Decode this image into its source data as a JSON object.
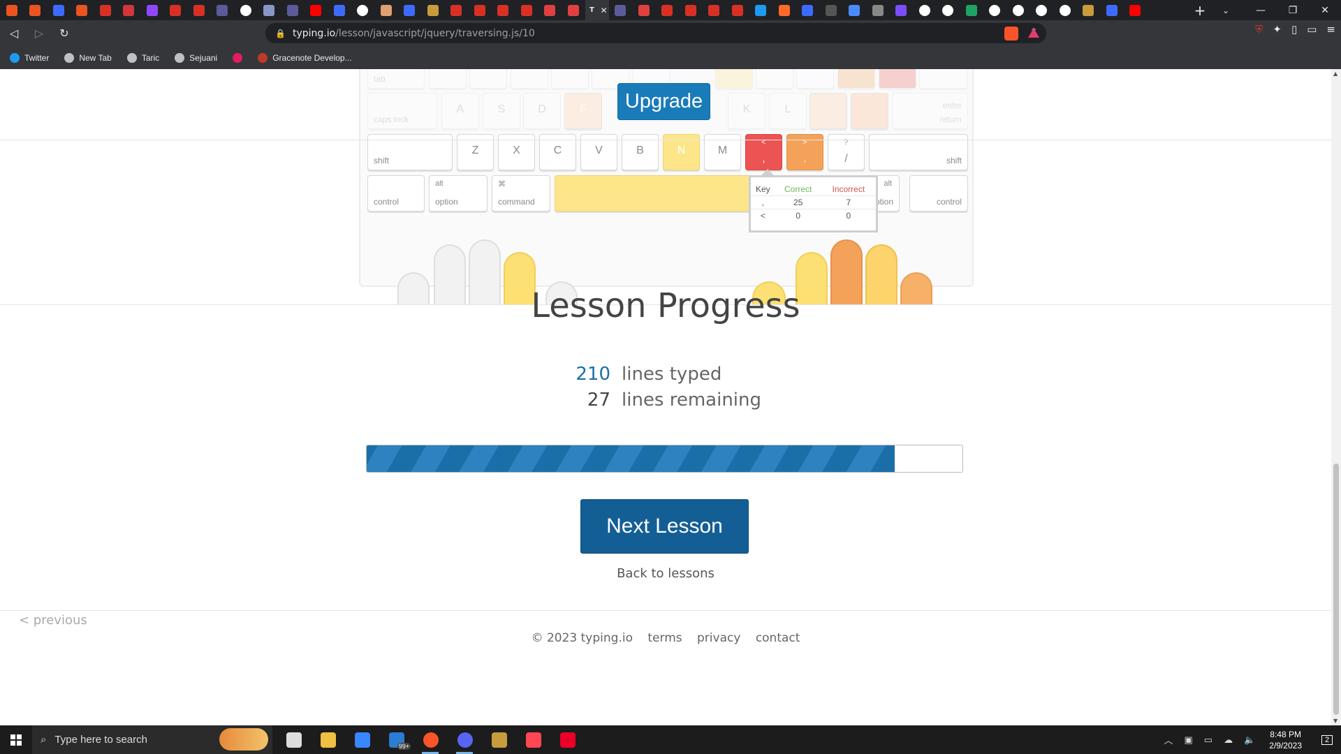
{
  "browser": {
    "tabs": [
      {
        "icon": "ubuntu-icon",
        "color": "#e95420"
      },
      {
        "icon": "ubuntu-icon",
        "color": "#e95420"
      },
      {
        "icon": "app-icon",
        "color": "#3d6bff"
      },
      {
        "icon": "ubuntu-icon",
        "color": "#e95420"
      },
      {
        "icon": "gmail-icon",
        "color": "#d93025"
      },
      {
        "icon": "riot-icon",
        "color": "#d13639"
      },
      {
        "icon": "twitch-icon",
        "color": "#9146ff"
      },
      {
        "icon": "gmail-icon",
        "color": "#d93025"
      },
      {
        "icon": "gmail-icon",
        "color": "#d93025"
      },
      {
        "icon": "mobalytics-icon",
        "color": "#5b5b9b"
      },
      {
        "icon": "google-icon",
        "color": "#ffffff"
      },
      {
        "icon": "shield-icon",
        "color": "#8896c8"
      },
      {
        "icon": "mobalytics-icon",
        "color": "#5b5b9b"
      },
      {
        "icon": "youtube-icon",
        "color": "#ff0000"
      },
      {
        "icon": "bookmark-icon",
        "color": "#3d6bff"
      },
      {
        "icon": "google-icon",
        "color": "#ffffff"
      },
      {
        "icon": "site-icon",
        "color": "#e0a070"
      },
      {
        "icon": "app-icon",
        "color": "#3d6bff"
      },
      {
        "icon": "coin-icon",
        "color": "#c89b3c"
      },
      {
        "icon": "gmail-icon",
        "color": "#d93025"
      },
      {
        "icon": "gmail-icon",
        "color": "#d93025"
      },
      {
        "icon": "gmail-icon",
        "color": "#d93025"
      },
      {
        "icon": "gmail-icon",
        "color": "#d93025"
      },
      {
        "icon": "shield-icon",
        "color": "#e04040"
      },
      {
        "icon": "shield-icon",
        "color": "#e04040"
      },
      {
        "icon": "typing-icon",
        "color": "#35363a",
        "active": true,
        "label": "T"
      },
      {
        "icon": "mobalytics-icon",
        "color": "#5b5b9b"
      },
      {
        "icon": "shield-icon",
        "color": "#e04040"
      },
      {
        "icon": "gmail-icon",
        "color": "#d93025"
      },
      {
        "icon": "gmail-icon",
        "color": "#d93025"
      },
      {
        "icon": "gmail-icon",
        "color": "#d93025"
      },
      {
        "icon": "gmail-icon",
        "color": "#d93025"
      },
      {
        "icon": "twitter-icon",
        "color": "#1d9bf0"
      },
      {
        "icon": "site-icon",
        "color": "#ff6a2b"
      },
      {
        "icon": "bookmark-icon",
        "color": "#3d6bff"
      },
      {
        "icon": "site-icon",
        "color": "#555555"
      },
      {
        "icon": "site-icon",
        "color": "#4a8cff"
      },
      {
        "icon": "site-icon",
        "color": "#888888"
      },
      {
        "icon": "crown-icon",
        "color": "#7b4dff"
      },
      {
        "icon": "google-icon",
        "color": "#ffffff"
      },
      {
        "icon": "google-icon",
        "color": "#ffffff"
      },
      {
        "icon": "star-icon",
        "color": "#1ea362"
      },
      {
        "icon": "google-icon",
        "color": "#ffffff"
      },
      {
        "icon": "google-icon",
        "color": "#ffffff"
      },
      {
        "icon": "google-icon",
        "color": "#ffffff"
      },
      {
        "icon": "google-icon",
        "color": "#ffffff"
      },
      {
        "icon": "coin-icon",
        "color": "#c89b3c"
      },
      {
        "icon": "app-icon",
        "color": "#3d6bff"
      },
      {
        "icon": "youtube-icon",
        "color": "#ff0000"
      }
    ],
    "new_tab": "+",
    "url_host": "typing.io",
    "url_path": "/lesson/javascript/jquery/traversing.js/10",
    "bookmarks": [
      {
        "label": "Twitter",
        "icon": "twitter-icon"
      },
      {
        "label": "New Tab",
        "icon": "globe-icon"
      },
      {
        "label": "Taric",
        "icon": "globe-icon"
      },
      {
        "label": "Sejuani",
        "icon": "globe-icon"
      },
      {
        "label": "",
        "icon": "slack-icon"
      },
      {
        "label": "Gracenote Develop...",
        "icon": "gracenote-icon"
      }
    ]
  },
  "keyboard": {
    "upgrade_label": "Upgrade",
    "row_home": {
      "caps": "caps lock",
      "keys": [
        "A",
        "S",
        "D",
        "F",
        "K",
        "L"
      ],
      "enter": "enter",
      "return": "return"
    },
    "row_top_label": "tab",
    "row_shift": {
      "shift_left": "shift",
      "keys": [
        "Z",
        "X",
        "C",
        "V",
        "B",
        "N",
        "M"
      ],
      "comma_top": "<",
      "comma": ",",
      "period_top": ">",
      "period": ".",
      "slash_top": "?",
      "slash": "/",
      "shift_right": "shift"
    },
    "row_bottom": {
      "control_left": "control",
      "alt_left_top": "alt",
      "option_left": "option",
      "command_top": "⌘",
      "command": "command",
      "alt_right_top": "alt",
      "option_right": "option",
      "control_right": "control"
    },
    "colors": {
      "yellow": "#fde68a",
      "red": "#ec5353",
      "orange": "#f4a259",
      "light_orange": "#fcdcc0",
      "pink": "#f7c2c2"
    }
  },
  "tooltip": {
    "headers": [
      "Key",
      "Correct",
      "Incorrect"
    ],
    "rows": [
      [
        ",",
        "25",
        "7"
      ],
      [
        "<",
        "0",
        "0"
      ]
    ]
  },
  "progress": {
    "title": "Lesson Progress",
    "typed_count": "210",
    "typed_label": "lines typed",
    "remaining_count": "27",
    "remaining_label": "lines remaining",
    "fraction_complete": 0.886,
    "next_button": "Next Lesson",
    "back_link": "Back to lessons"
  },
  "footer": {
    "previous": "< previous",
    "copyright": "© 2023 typing.io",
    "links": [
      "terms",
      "privacy",
      "contact"
    ]
  },
  "taskbar": {
    "search_placeholder": "Type here to search",
    "apps": [
      {
        "icon": "task-view-icon",
        "color": "#dddddd"
      },
      {
        "icon": "file-explorer-icon",
        "color": "#f0c040"
      },
      {
        "icon": "store-icon",
        "color": "#3a86ff"
      },
      {
        "icon": "mail-icon",
        "color": "#2b7cd3",
        "badge": "99+"
      },
      {
        "icon": "brave-icon",
        "color": "#fb542b",
        "active": true
      },
      {
        "icon": "discord-icon",
        "color": "#5865f2",
        "active": true
      },
      {
        "icon": "league-icon",
        "color": "#c89b3c"
      },
      {
        "icon": "valorant-icon",
        "color": "#ff4655"
      },
      {
        "icon": "riot-client-icon",
        "color": "#eb0029"
      }
    ],
    "time": "8:48 PM",
    "date": "2/9/2023",
    "notification_count": "2"
  }
}
